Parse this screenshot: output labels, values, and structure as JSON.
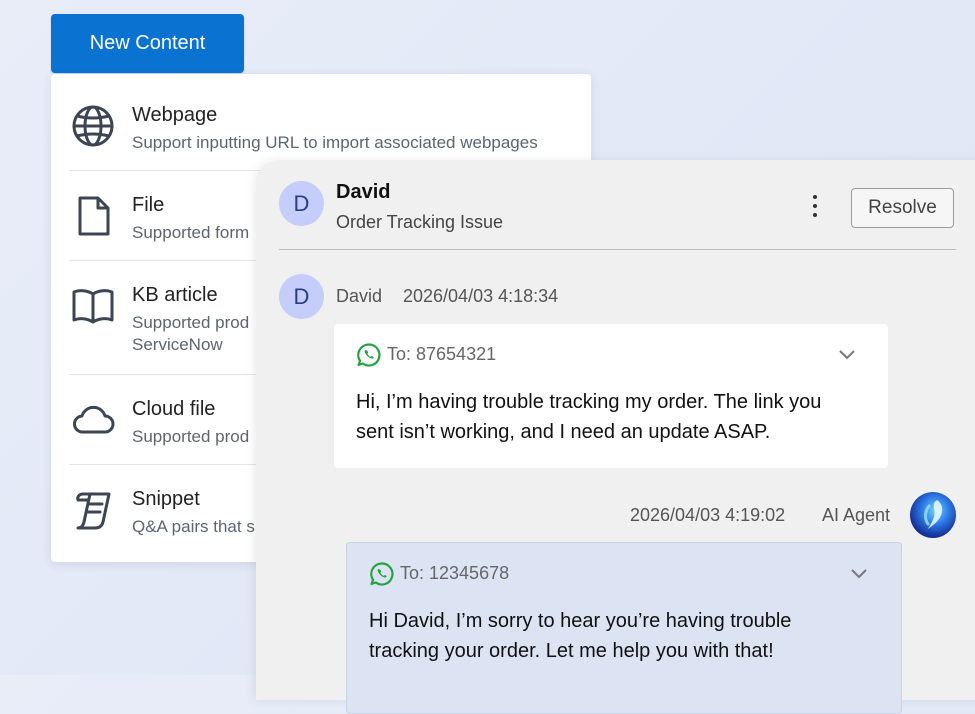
{
  "new_content_button": "New Content",
  "menu": {
    "items": [
      {
        "title": "Webpage",
        "desc": "Support inputting URL to import associated webpages",
        "desc2": ""
      },
      {
        "title": "File",
        "desc": "Supported form",
        "desc2": ""
      },
      {
        "title": "KB article",
        "desc": "Supported prod",
        "desc2": "ServiceNow"
      },
      {
        "title": "Cloud file",
        "desc": "Supported prod",
        "desc2": ""
      },
      {
        "title": "Snippet",
        "desc": "Q&A pairs that s",
        "desc2": ""
      }
    ]
  },
  "chat": {
    "avatar_initial": "D",
    "contact_name": "David",
    "subject": "Order Tracking Issue",
    "resolve_label": "Resolve",
    "messages": [
      {
        "sender": "David",
        "avatar_initial": "D",
        "time": "2026/04/03 4:18:34",
        "to": "To: 87654321",
        "line1": "Hi, I’m having trouble tracking my order. The link you",
        "line2": "sent isn’t working, and I need an update ASAP."
      },
      {
        "sender": "AI Agent",
        "time": "2026/04/03 4:19:02",
        "to": "To: 12345678",
        "line1": "Hi David, I’m sorry to hear you’re having trouble",
        "line2": "tracking your order. Let me help you with that!"
      }
    ]
  },
  "colors": {
    "primary_button": "#0a73d2",
    "avatar_bg": "#c5cdfa",
    "incoming_bubble": "#ffffff",
    "outgoing_bubble": "#dce4f3",
    "whatsapp_green": "#25a244"
  },
  "icons": {
    "webpage": "globe-icon",
    "file": "file-icon",
    "kb_article": "book-icon",
    "cloud_file": "cloud-icon",
    "snippet": "scroll-icon",
    "channel": "whatsapp-icon",
    "expand": "chevron-down-icon",
    "more": "more-vertical-icon"
  }
}
